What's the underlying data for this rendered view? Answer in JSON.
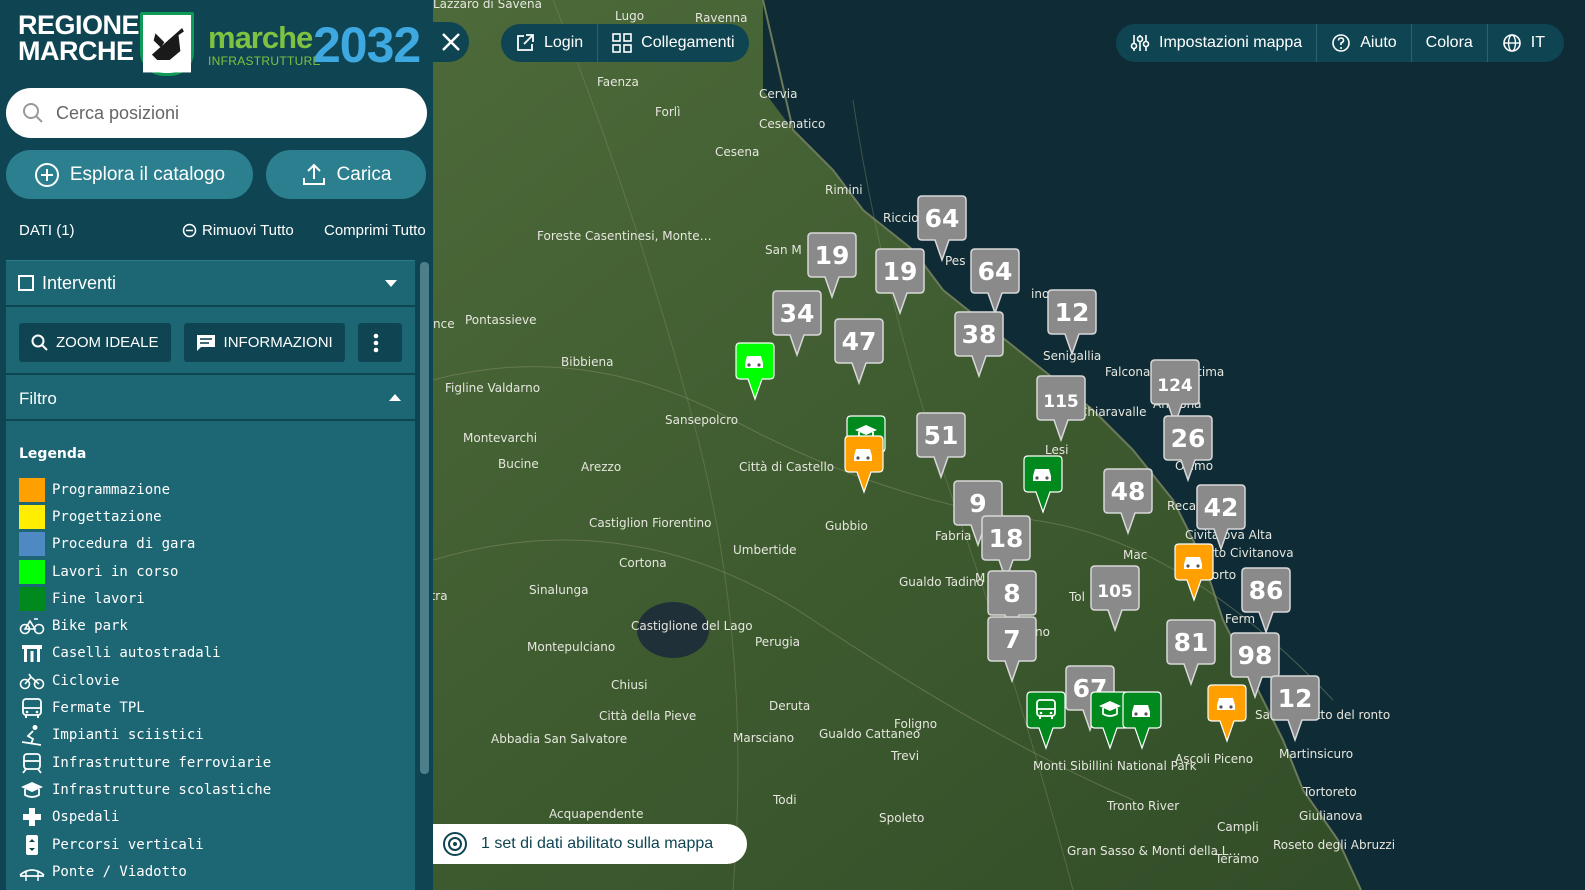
{
  "brand": {
    "regione_line1": "REGIONE",
    "regione_line2": "MARCHE",
    "marche": "marche",
    "infra": "INFRASTRUTTURE",
    "year": "2032"
  },
  "search": {
    "placeholder": "Cerca posizioni"
  },
  "actions": {
    "explore": "Esplora il catalogo",
    "upload": "Carica"
  },
  "dati": {
    "title": "DATI (1)",
    "remove_all": "Rimuovi Tutto",
    "collapse_all": "Comprimi Tutto"
  },
  "layer": {
    "name": "Interventi",
    "zoom_label": "ZOOM IDEALE",
    "info_label": "INFORMAZIONI",
    "filter_label": "Filtro"
  },
  "legend": {
    "title": "Legenda",
    "status_items": [
      {
        "label": "Programmazione",
        "color": "#ff9f00"
      },
      {
        "label": "Progettazione",
        "color": "#ffee00"
      },
      {
        "label": "Procedura di gara",
        "color": "#4f89c4"
      },
      {
        "label": "Lavori in corso",
        "color": "#00ff00"
      },
      {
        "label": "Fine lavori",
        "color": "#008a1e"
      }
    ],
    "category_items": [
      {
        "label": "Bike park",
        "icon": "bike-icon"
      },
      {
        "label": "Caselli autostradali",
        "icon": "toll-icon"
      },
      {
        "label": "Ciclovie",
        "icon": "bicycle-icon"
      },
      {
        "label": "Fermate TPL",
        "icon": "bus-icon"
      },
      {
        "label": "Impianti sciistici",
        "icon": "ski-icon"
      },
      {
        "label": "Infrastrutture ferroviarie",
        "icon": "train-icon"
      },
      {
        "label": "Infrastrutture scolastiche",
        "icon": "school-icon"
      },
      {
        "label": "Ospedali",
        "icon": "hospital-icon"
      },
      {
        "label": "Percorsi verticali",
        "icon": "elevator-icon"
      },
      {
        "label": "Ponte / Viadotto",
        "icon": "bridge-icon"
      }
    ]
  },
  "toolbar": {
    "login": "Login",
    "links": "Collegamenti",
    "map_settings": "Impostazioni mappa",
    "help": "Aiuto",
    "color": "Colora",
    "language": "IT"
  },
  "status": {
    "text": "1 set di dati abilitato sulla mappa"
  },
  "map": {
    "cluster_color": "#8a8a8a",
    "clusters": [
      "64",
      "19",
      "19",
      "64",
      "34",
      "47",
      "38",
      "12",
      "115",
      "124",
      "51",
      "26",
      "48",
      "9",
      "42",
      "18",
      "105",
      "8",
      "86",
      "7",
      "81",
      "98",
      "67",
      "12"
    ],
    "places": [
      "Lazzaro di Savena",
      "Lugo",
      "Ravenna",
      "Faenza",
      "Forlì",
      "Cervia",
      "Cesenatico",
      "Cesena",
      "Rimini",
      "Riccione",
      "San M",
      "Pes",
      "Pontassieve",
      "Figline Valdarno",
      "Bibbiena",
      "Foreste Casentinesi, Monte Falterona and Campigna National Park",
      "Sansepolcro",
      "Senigallia",
      "Falconara Marittima",
      "Montevarchi",
      "Bucine",
      "Arezzo",
      "Città di Castello",
      "Chiaravalle",
      "An cona",
      "Osimo",
      "Reca",
      "Gubbio",
      "Fabria",
      "Castiglion Fiorentino",
      "Umbertide",
      "Civita ova Alta",
      "Porto Civitanova",
      "Cortona",
      "Sinalunga",
      "Gualdo Tadino",
      "Mac",
      "Tol",
      "Porto",
      "Castiglione del Lago",
      "Perugia",
      "Montepulciano",
      "Ferm",
      "Chiusi",
      "Città della Pieve",
      "Deruta",
      "Abbadia San Salvatore",
      "Marsciano",
      "Gualdo Cattaneo",
      "Foligno",
      "Trevi",
      "Monti Sibillini National Park",
      "Ascoli Piceno",
      "San Be detto del ronto",
      "Martinsicuro",
      "Todi",
      "Acquapendente",
      "Spoleto",
      "Tortoreto",
      "Giulianova",
      "Campli",
      "Roseto degli Abruzzi",
      "Teramo",
      "Gran Sasso & Monti della Laga National Park",
      "Tronto River",
      "Lesi",
      "M",
      "no",
      "ino",
      "nce",
      "ntra"
    ],
    "status_markers": [
      {
        "status": "Lavori in corso",
        "icon": "car-icon"
      },
      {
        "status": "Fine lavori",
        "icon": "school-icon"
      },
      {
        "status": "Programmazione",
        "icon": "car-icon"
      },
      {
        "status": "Fine lavori",
        "icon": "car-icon"
      },
      {
        "status": "Programmazione",
        "icon": "car-icon"
      },
      {
        "status": "Fine lavori",
        "icon": "bus-icon"
      },
      {
        "status": "Fine lavori",
        "icon": "school-icon"
      },
      {
        "status": "Fine lavori",
        "icon": "car-icon"
      },
      {
        "status": "Programmazione",
        "icon": "car-icon"
      }
    ]
  }
}
